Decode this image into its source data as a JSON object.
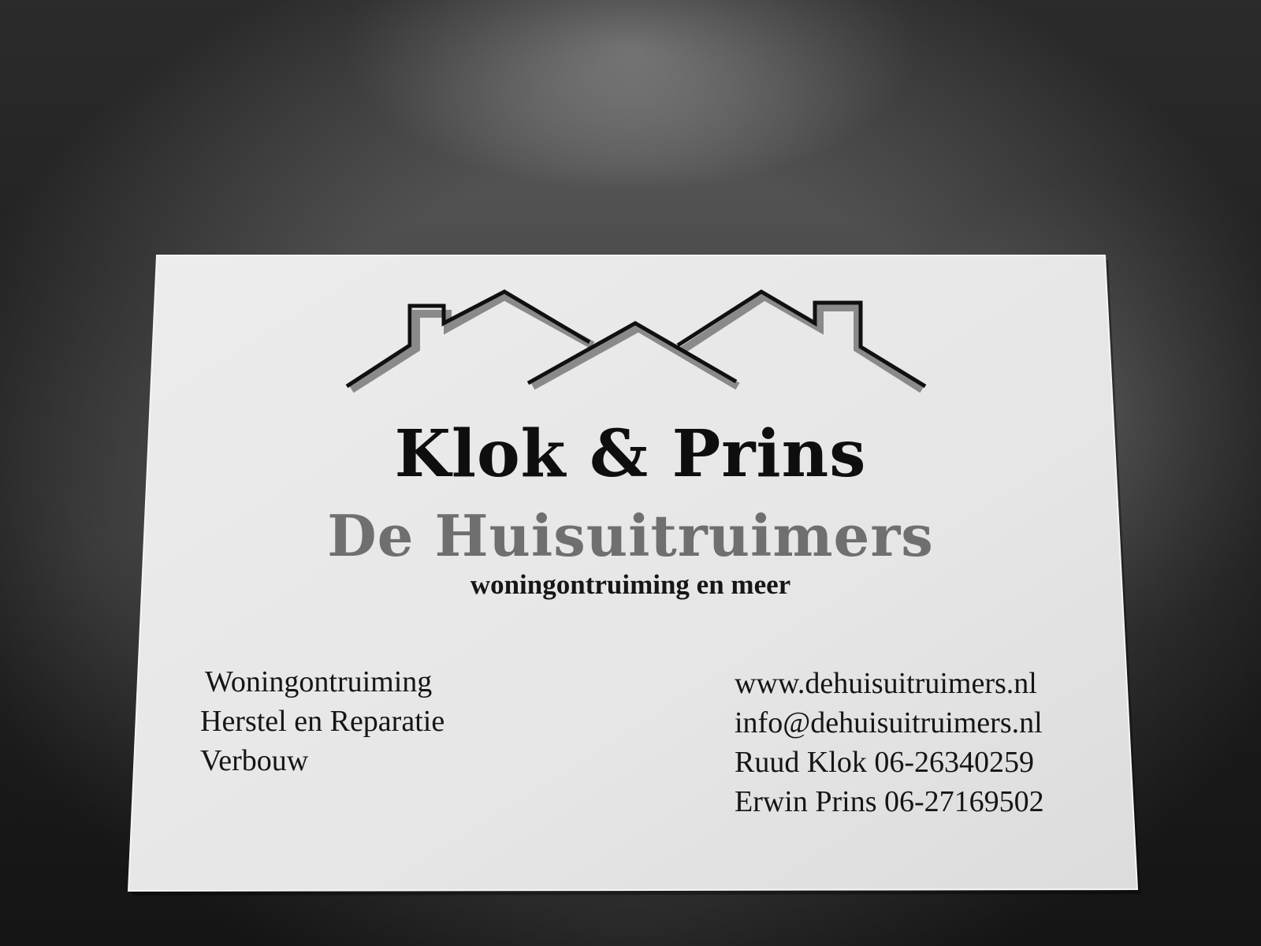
{
  "card": {
    "brand_name": "Klok & Prins",
    "brand_subtitle": "De Huisuitruimers",
    "tagline": "woningontruiming en meer",
    "services": [
      "Woningontruiming",
      "Herstel en Reparatie",
      "Verbouw"
    ],
    "contact": {
      "website": "www.dehuisuitruimers.nl",
      "email": "info@dehuisuitruimers.nl",
      "person_1": "Ruud Klok 06-26340259",
      "person_2": "Erwin Prins 06-27169502"
    }
  },
  "colors": {
    "card_paper": "#e9e9e9",
    "ink_dark": "#111111",
    "ink_grey": "#6f6f6f",
    "background": "#3b3b3b"
  },
  "icons": {
    "logo": "rooftops-logo-icon"
  }
}
